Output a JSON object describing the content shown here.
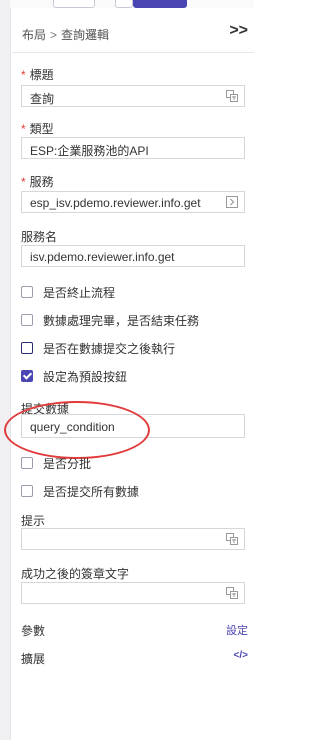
{
  "breadcrumb": {
    "root": "布局",
    "sep": ">",
    "current": "查詢邏輯"
  },
  "collapse_icon": ">>",
  "fields": {
    "title": {
      "label": "標題",
      "required": "*",
      "value": "查詢"
    },
    "type": {
      "label": "類型",
      "required": "*",
      "value": "ESP:企業服務池的API"
    },
    "service": {
      "label": "服務",
      "required": "*",
      "value": "esp_isv.pdemo.reviewer.info.get"
    },
    "service_name": {
      "label": "服務名",
      "value": "isv.pdemo.reviewer.info.get"
    }
  },
  "checkboxes": [
    {
      "label": "是否終止流程",
      "checked": false
    },
    {
      "label": "數據處理完畢，是否結束任務",
      "checked": false
    },
    {
      "label": "是否在數據提交之後執行",
      "checked": false
    },
    {
      "label": "設定為預設按鈕",
      "checked": true
    }
  ],
  "submit_data": {
    "label": "提交數據",
    "value": "query_condition"
  },
  "checkboxes2": [
    {
      "label": "是否分批",
      "checked": false
    },
    {
      "label": "是否提交所有數據",
      "checked": false
    }
  ],
  "hint": {
    "label": "提示",
    "value": ""
  },
  "success_sign": {
    "label": "成功之後的簽章文字",
    "value": ""
  },
  "params": {
    "label": "參數",
    "action": "設定"
  },
  "extension": {
    "label": "擴展",
    "icon": "code-icon",
    "glyph": "</>"
  },
  "colors": {
    "accent": "#4b45b4",
    "required": "#e33b3b",
    "annotation": "#e23b3b"
  }
}
